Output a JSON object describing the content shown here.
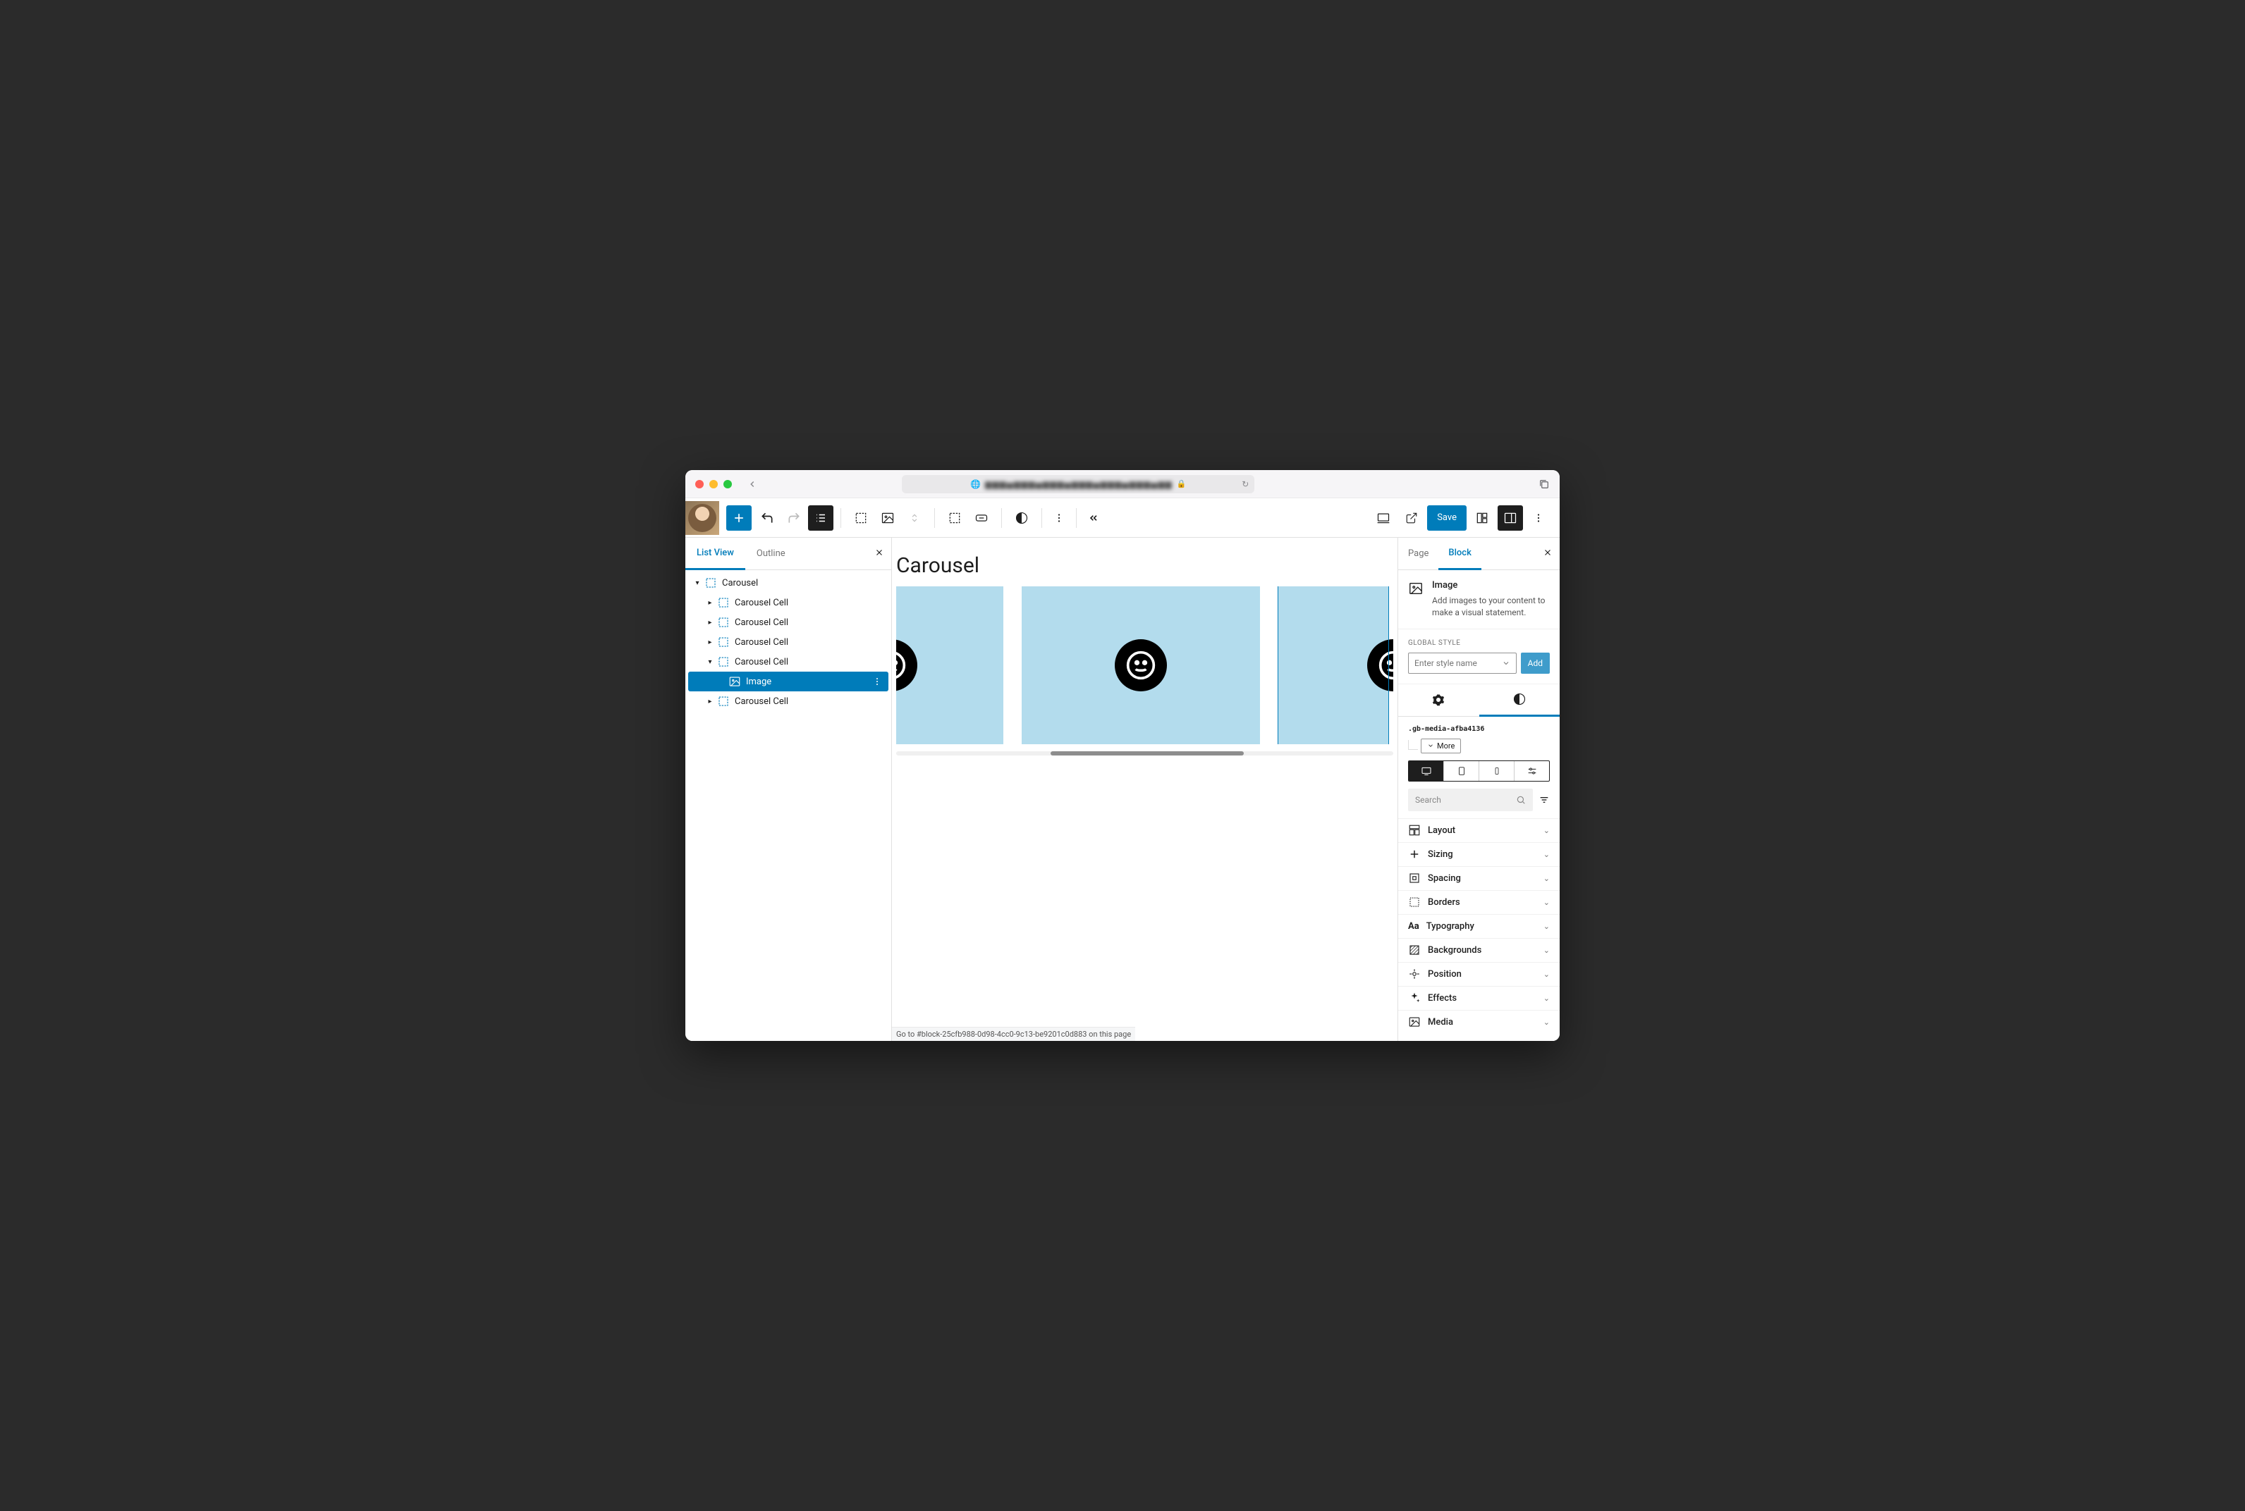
{
  "browser": {
    "url_masked": "▆▆▆▅▆▆▆▅▆▆▆▅▆▆▆▅▆▆▆▅▆▆▆▅▆▆"
  },
  "toolbar": {
    "save_label": "Save"
  },
  "left_panel": {
    "tabs": {
      "list_view": "List View",
      "outline": "Outline"
    },
    "tree": {
      "root": "Carousel",
      "cells": [
        "Carousel Cell",
        "Carousel Cell",
        "Carousel Cell",
        "Carousel Cell",
        "Carousel Cell"
      ],
      "image": "Image"
    }
  },
  "canvas": {
    "title": "Carousel"
  },
  "right_panel": {
    "tabs": {
      "page": "Page",
      "block": "Block"
    },
    "block_info": {
      "title": "Image",
      "desc": "Add images to your content to make a visual statement."
    },
    "global_style": {
      "label": "GLOBAL STYLE",
      "placeholder": "Enter style name",
      "add": "Add"
    },
    "selector": ".gb-media-afba4136",
    "more": "More",
    "search_placeholder": "Search",
    "accordion": [
      "Layout",
      "Sizing",
      "Spacing",
      "Borders",
      "Typography",
      "Backgrounds",
      "Position",
      "Effects",
      "Media"
    ]
  },
  "status_bar": "Go to #block-25cfb988-0d98-4cc0-9c13-be9201c0d883 on this page"
}
